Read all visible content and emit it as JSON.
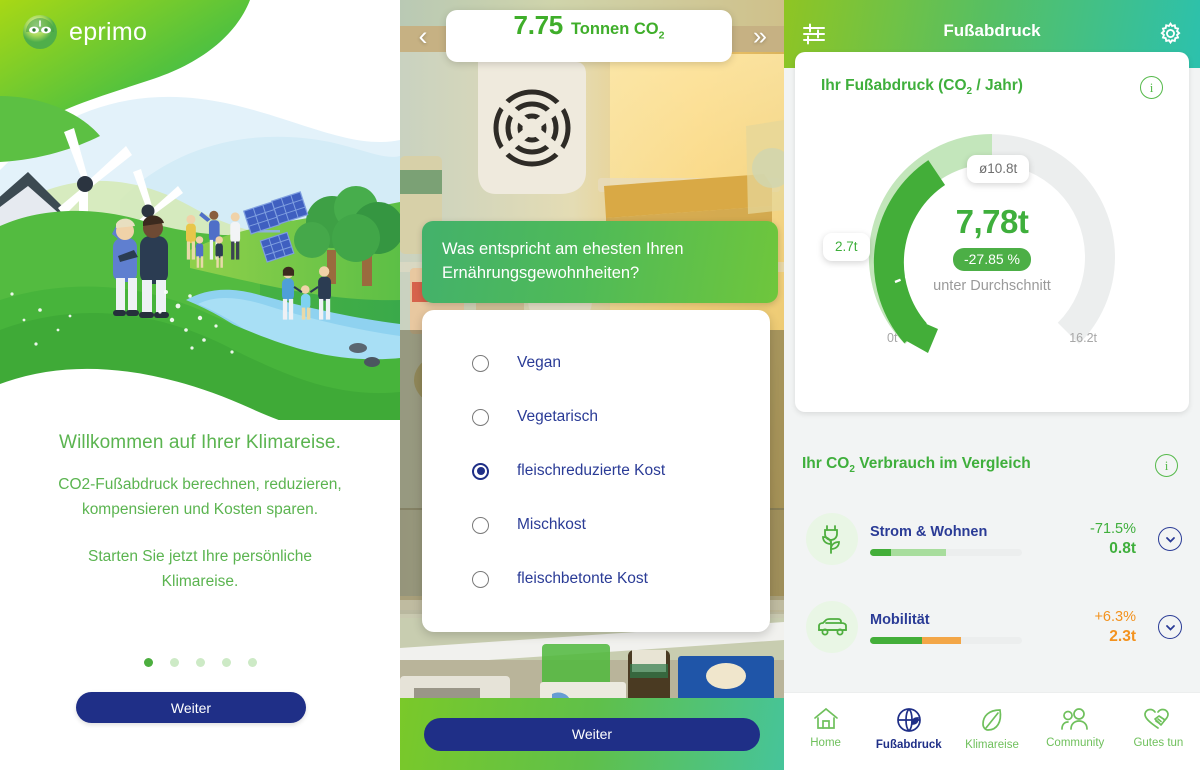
{
  "panel1": {
    "brand": "eprimo",
    "title": "Willkommen auf Ihrer Klimareise.",
    "subtitle_line1": "CO2-Fußabdruck berechnen, reduzieren,",
    "subtitle_line2": "kompensieren und Kosten sparen.",
    "subtitle2_line1": "Starten Sie jetzt Ihre persönliche",
    "subtitle2_line2": "Klimareise.",
    "dots_total": 5,
    "dots_active_index": 0,
    "cta_label": "Weiter",
    "accent_green": "#5bb450",
    "cta_color": "#1f2f87"
  },
  "panel2": {
    "counter_value": "7.75",
    "counter_unit": "Tonnen CO",
    "counter_unit_sub": "2",
    "back_icon": "chevron-left-icon",
    "forward_icon": "double-chevron-right-icon",
    "question": "Was entspricht am ehesten Ihren Ernährungsgewohnheiten?",
    "options": [
      {
        "label": "Vegan",
        "selected": false
      },
      {
        "label": "Vegetarisch",
        "selected": false
      },
      {
        "label": "fleischreduzierte Kost",
        "selected": true
      },
      {
        "label": "Mischkost",
        "selected": false
      },
      {
        "label": "fleischbetonte Kost",
        "selected": false
      }
    ],
    "cta_label": "Weiter"
  },
  "panel3": {
    "header": {
      "left_icon": "sliders-icon",
      "title": "Fußabdruck",
      "right_icon": "gear-icon"
    },
    "card": {
      "title_main": "Ihr Fußabdruck (CO",
      "title_sub": "2",
      "title_rest": " / Jahr)",
      "info_icon": "info-icon"
    },
    "compare": {
      "title_main": "Ihr CO",
      "title_sub": "2",
      "title_rest": " Verbrauch im Vergleich",
      "info_icon": "info-icon",
      "rows": [
        {
          "icon": "plant-plug-icon",
          "label": "Strom & Wohnen",
          "pct": "-71.5%",
          "value": "0.8t",
          "tone": "green",
          "bar_dark_pct": 14,
          "bar_light_pct": 36,
          "chevron_icon": "chevron-down-icon"
        },
        {
          "icon": "car-icon",
          "label": "Mobilität",
          "pct": "+6.3%",
          "value": "2.3t",
          "tone": "orange",
          "bar_dark_pct": 34,
          "bar_light_pct": 26,
          "chevron_icon": "chevron-down-icon"
        }
      ]
    },
    "nav": [
      {
        "icon": "home-icon",
        "label": "Home",
        "active": false
      },
      {
        "icon": "globe-leaf-icon",
        "label": "Fußabdruck",
        "active": true
      },
      {
        "icon": "leaf-icon",
        "label": "Klimareise",
        "active": false
      },
      {
        "icon": "people-icon",
        "label": "Community",
        "active": false
      },
      {
        "icon": "handshake-heart-icon",
        "label": "Gutes tun",
        "active": false
      }
    ]
  },
  "chart_data": {
    "type": "gauge",
    "title": "Ihr Fußabdruck (CO2 / Jahr)",
    "value": "7,78t",
    "value_number": 7.78,
    "unit": "t",
    "delta_label": "-27.85 %",
    "delta_number": -27.85,
    "delta_note": "unter Durchschnitt",
    "axis_min_label": "0t",
    "axis_max_label": "16.2t",
    "range": [
      0,
      16.2
    ],
    "markers": [
      {
        "label": "2.7t",
        "value": 2.7,
        "type": "target-min"
      },
      {
        "label": "ø10.8t",
        "value": 10.8,
        "type": "average"
      }
    ],
    "segments": [
      {
        "name": "user",
        "from": 0,
        "to": 7.78,
        "color": "#43ae39"
      },
      {
        "name": "to-average",
        "from": 7.78,
        "to": 10.8,
        "color": "#c3e6bb"
      },
      {
        "name": "remaining",
        "from": 10.8,
        "to": 16.2,
        "color": "#eceeee"
      }
    ],
    "grid": false,
    "legend": "none"
  }
}
